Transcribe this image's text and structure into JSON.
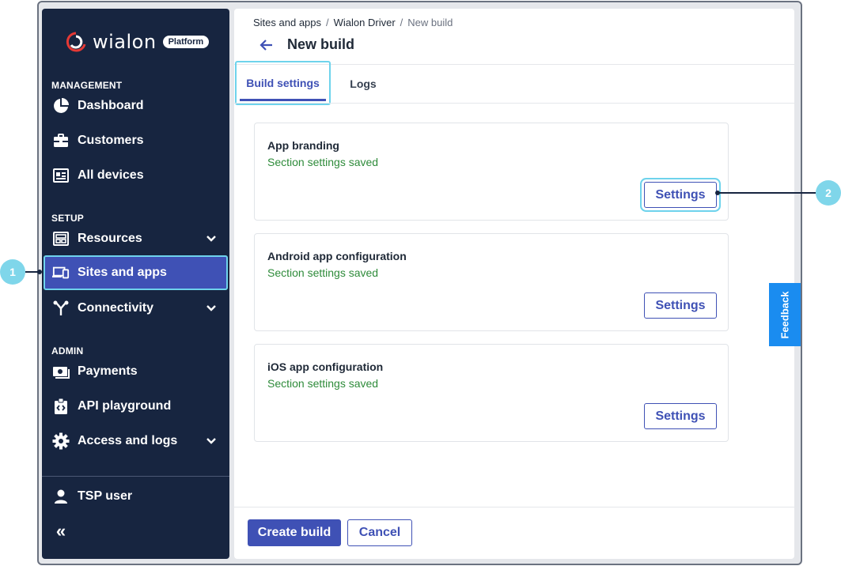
{
  "logo": {
    "word": "wialon",
    "badge": "Platform"
  },
  "sidebar": {
    "sections": {
      "management": "MANAGEMENT",
      "setup": "SETUP",
      "admin": "ADMIN"
    },
    "items": [
      {
        "label": "Dashboard",
        "icon": "pie-chart-icon"
      },
      {
        "label": "Customers",
        "icon": "briefcase-icon"
      },
      {
        "label": "All devices",
        "icon": "devices-list-icon"
      },
      {
        "label": "Resources",
        "icon": "layout-icon"
      },
      {
        "label": "Sites and apps",
        "icon": "devices-icon"
      },
      {
        "label": "Connectivity",
        "icon": "network-icon"
      },
      {
        "label": "Payments",
        "icon": "payment-icon"
      },
      {
        "label": "API playground",
        "icon": "code-icon"
      },
      {
        "label": "Access and logs",
        "icon": "gear-icon"
      }
    ],
    "user": "TSP user",
    "collapse": "«"
  },
  "breadcrumb": [
    "Sites and apps",
    "Wialon Driver",
    "New build"
  ],
  "page_title": "New build",
  "tabs": [
    {
      "label": "Build settings"
    },
    {
      "label": "Logs"
    }
  ],
  "cards": [
    {
      "title": "App branding",
      "status": "Section settings saved",
      "button": "Settings"
    },
    {
      "title": "Android app configuration",
      "status": "Section settings saved",
      "button": "Settings"
    },
    {
      "title": "iOS app configuration",
      "status": "Section settings saved",
      "button": "Settings"
    }
  ],
  "footer": {
    "create": "Create build",
    "cancel": "Cancel"
  },
  "feedback": "Feedback",
  "markers": [
    "1",
    "2"
  ],
  "colors": {
    "sidebar": "#172540",
    "accent": "#3f51b5",
    "highlight": "#6ed3ec",
    "success": "#2e8b3a",
    "feedback": "#1a8cf0"
  }
}
